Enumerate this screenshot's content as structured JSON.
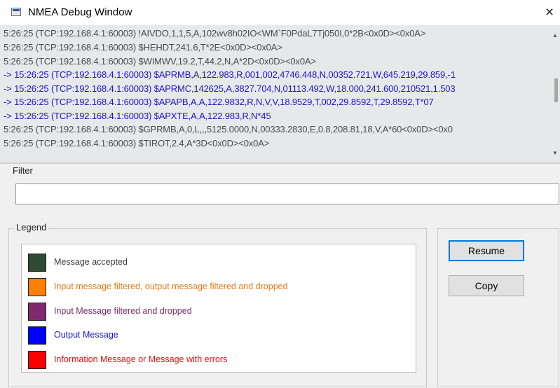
{
  "window": {
    "title": "NMEA Debug Window",
    "close_label": "×"
  },
  "log": {
    "lines": [
      {
        "text": "5:26:25 (TCP:192.168.4.1:60003) !AIVDO,1,1,5,A,102wv8h02IO<WM`F0PdaL7Tj050I,0*2B<0x0D><0x0A>",
        "kind": "accepted"
      },
      {
        "text": "5:26:25 (TCP:192.168.4.1:60003) $HEHDT,241.6,T*2E<0x0D><0x0A>",
        "kind": "accepted"
      },
      {
        "text": "5:26:25 (TCP:192.168.4.1:60003) $WIMWV,19.2,T,44.2,N,A*2D<0x0D><0x0A>",
        "kind": "accepted"
      },
      {
        "text": "-> 15:26:25 (TCP:192.168.4.1:60003) $APRMB,A,122.983,R,001,002,4746.448,N,00352.721,W,645.219,29.859,-1",
        "kind": "output"
      },
      {
        "text": "-> 15:26:25 (TCP:192.168.4.1:60003) $APRMC,142625,A,3827.704,N,01113.492,W,18.000,241.600,210521,1.503",
        "kind": "output"
      },
      {
        "text": "-> 15:26:25 (TCP:192.168.4.1:60003) $APAPB,A,A,122.9832,R,N,V,V,18.9529,T,002,29.8592,T,29.8592,T*07",
        "kind": "output"
      },
      {
        "text": "-> 15:26:25 (TCP:192.168.4.1:60003) $APXTE,A,A,122.983,R,N*45",
        "kind": "output"
      },
      {
        "text": "5:26:25 (TCP:192.168.4.1:60003) $GPRMB,A,0,L,,,5125.0000,N,00333.2830,E,0.8,208.81,18,V,A*60<0x0D><0x0",
        "kind": "accepted"
      },
      {
        "text": "5:26:25 (TCP:192.168.4.1:60003) $TIROT,2.4,A*3D<0x0D><0x0A>",
        "kind": "accepted"
      }
    ]
  },
  "filter": {
    "label": "Filter",
    "value": "",
    "placeholder": ""
  },
  "legend": {
    "label": "Legend",
    "items": [
      {
        "text": "Message accepted",
        "swatch": "#2e4a32",
        "text_color": "#3c3c3c"
      },
      {
        "text": "Input message filtered, output message filtered and dropped",
        "swatch": "#ff7f00",
        "text_color": "#e07a1a"
      },
      {
        "text": "Input Message filtered and dropped",
        "swatch": "#7f2a6e",
        "text_color": "#7a2a6a"
      },
      {
        "text": "Output Message",
        "swatch": "#0000ff",
        "text_color": "#1a16c8"
      },
      {
        "text": "Information Message or Message with errors",
        "swatch": "#ff0000",
        "text_color": "#e01010"
      }
    ]
  },
  "buttons": {
    "resume": "Resume",
    "copy": "Copy"
  },
  "colors": {
    "accepted_text": "#4a4a4a",
    "output_text": "#1a16c8",
    "focus_border": "#0078d7"
  }
}
